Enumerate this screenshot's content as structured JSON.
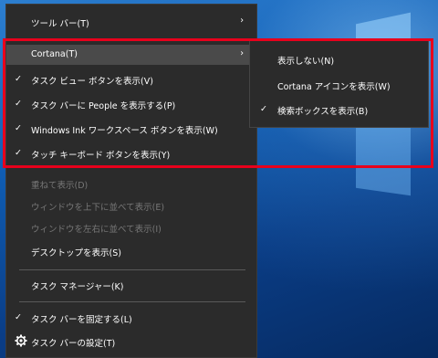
{
  "menu": {
    "items": [
      {
        "label": "ツール バー(T)",
        "checked": false,
        "disabled": false,
        "submenu": true
      },
      {
        "label": "Cortana(T)",
        "checked": false,
        "disabled": false,
        "submenu": true
      },
      {
        "label": "タスク ビュー ボタンを表示(V)",
        "checked": true,
        "disabled": false
      },
      {
        "label": "タスク バーに People を表示する(P)",
        "checked": true,
        "disabled": false
      },
      {
        "label": "Windows Ink ワークスペース ボタンを表示(W)",
        "checked": true,
        "disabled": false
      },
      {
        "label": "タッチ キーボード ボタンを表示(Y)",
        "checked": true,
        "disabled": false
      },
      {
        "label": "重ねて表示(D)",
        "checked": false,
        "disabled": true
      },
      {
        "label": "ウィンドウを上下に並べて表示(E)",
        "checked": false,
        "disabled": true
      },
      {
        "label": "ウィンドウを左右に並べて表示(I)",
        "checked": false,
        "disabled": true
      },
      {
        "label": "デスクトップを表示(S)",
        "checked": false,
        "disabled": false
      },
      {
        "label": "タスク マネージャー(K)",
        "checked": false,
        "disabled": false
      },
      {
        "label": "タスク バーを固定する(L)",
        "checked": true,
        "disabled": false
      },
      {
        "label": "タスク バーの設定(T)",
        "checked": false,
        "disabled": false,
        "icon": "gear-icon"
      }
    ]
  },
  "submenu": {
    "items": [
      {
        "label": "表示しない(N)",
        "checked": false
      },
      {
        "label": "Cortana アイコンを表示(W)",
        "checked": false
      },
      {
        "label": "検索ボックスを表示(B)",
        "checked": true
      }
    ]
  },
  "symbols": {
    "check": "✓",
    "arrow": "›"
  },
  "colors": {
    "menu_bg": "#2b2b2b",
    "highlight_border": "#e8001c",
    "disabled_text": "#777777"
  }
}
